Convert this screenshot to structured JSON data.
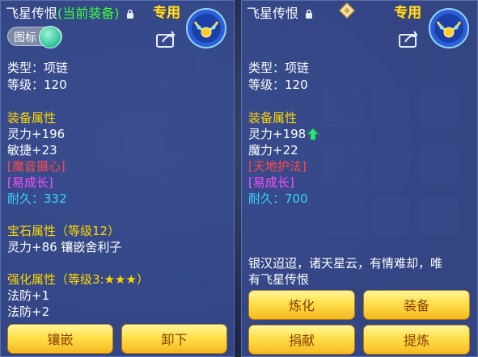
{
  "left": {
    "title_name": "飞星传恨",
    "title_equipped": "(当前装备)",
    "badge": "专用",
    "toggle_label": "图标",
    "type_line": "类型：项链",
    "level_line": "等级：120",
    "equip_attr_header": "装备属性",
    "stats": [
      "灵力+196",
      "敏捷+23"
    ],
    "special_skill": "[魔音摄心]",
    "special_effect": "[易成长]",
    "durability": "耐久：332",
    "gem_header": "宝石属性（等级12）",
    "gem_line": "灵力+86 镶嵌舍利子",
    "enhance_header": "强化属性（等级3:★★★）",
    "enhance_lines": [
      "法防+1",
      "法防+2"
    ],
    "buttons": {
      "inlay": "镶嵌",
      "unequip": "卸下"
    }
  },
  "right": {
    "title_name": "飞星传恨",
    "badge": "专用",
    "type_line": "类型：项链",
    "level_line": "等级：120",
    "equip_attr_header": "装备属性",
    "stats": [
      "灵力+198",
      "魔力+22"
    ],
    "special_skill": "[天地护法]",
    "special_effect": "[易成长]",
    "durability": "耐久：700",
    "description_line1": "银汉迢迢，诸天星云，有情难却，唯",
    "description_line2": "有飞星传恨",
    "buttons": {
      "refine": "炼化",
      "equip": "装备",
      "donate": "捐献",
      "extract": "提炼"
    }
  }
}
